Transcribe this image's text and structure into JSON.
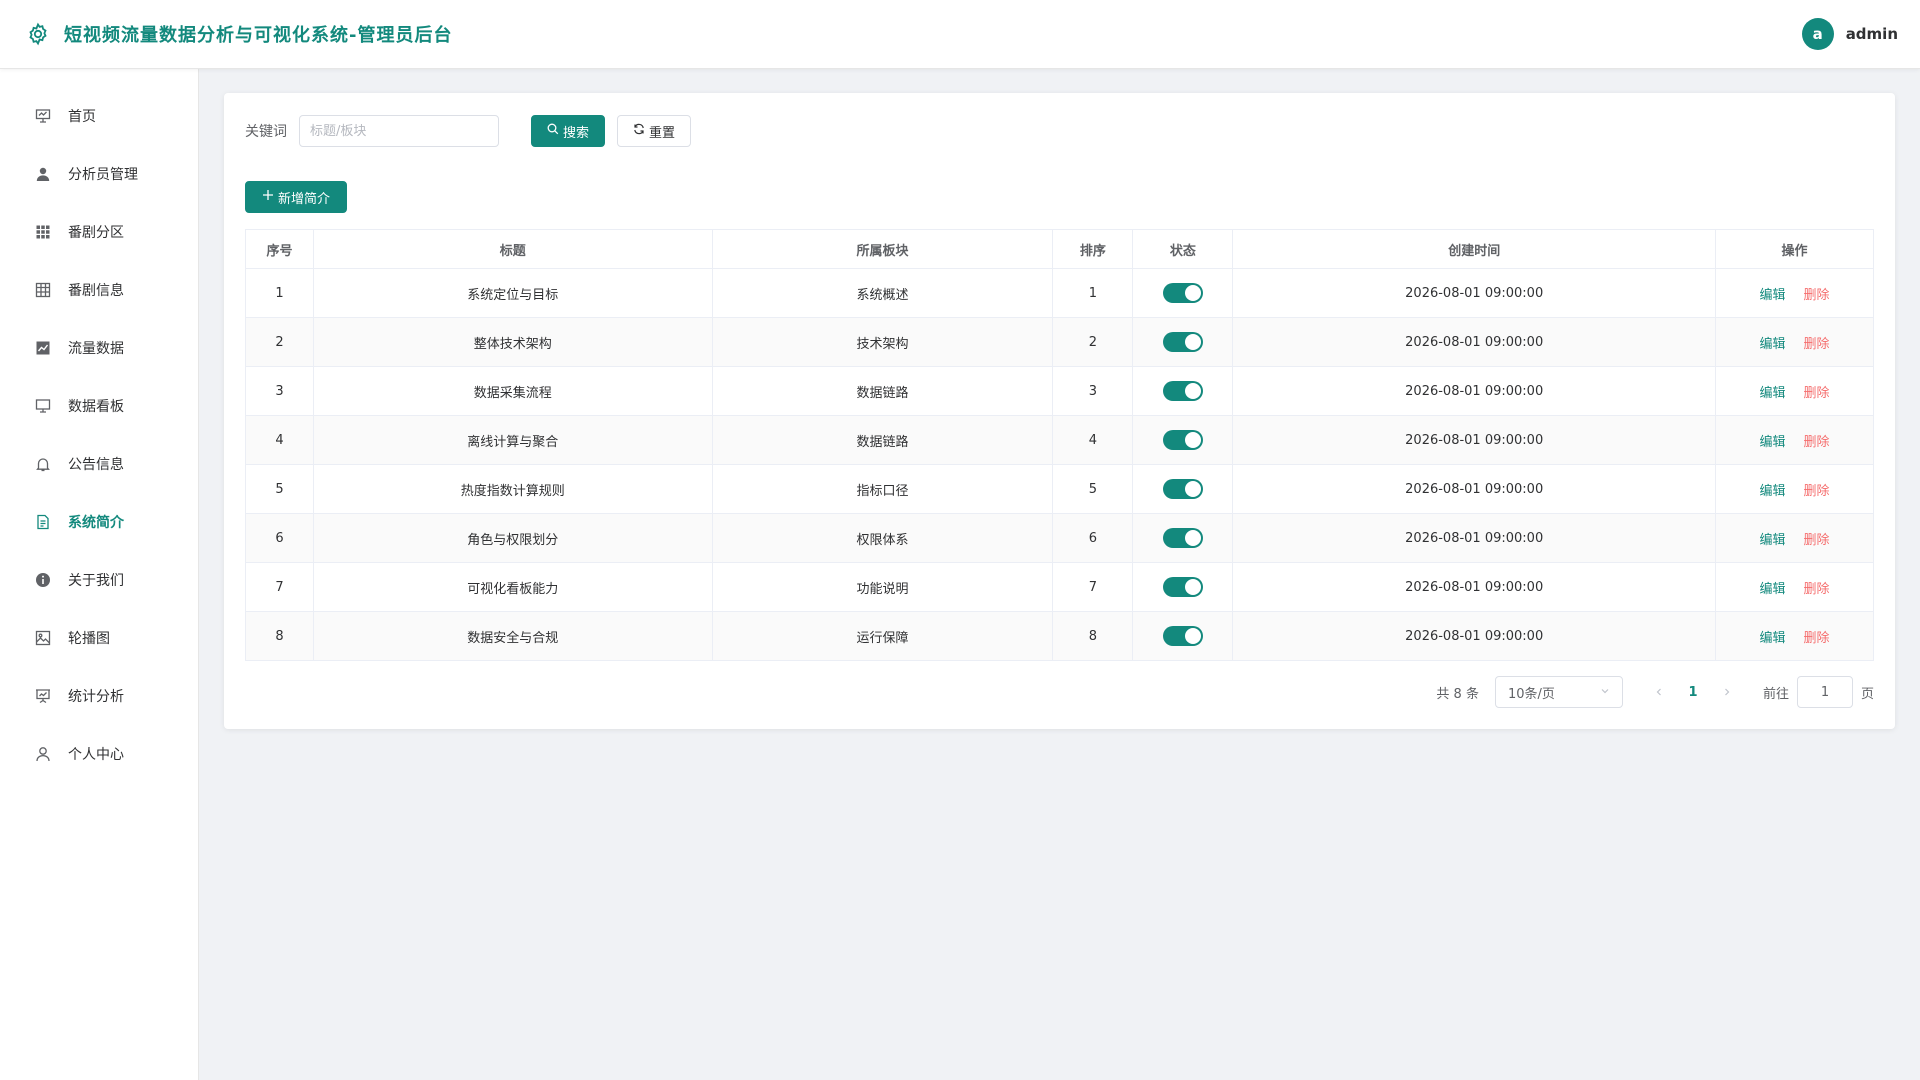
{
  "header": {
    "app_title": "短视频流量数据分析与可视化系统-管理员后台",
    "logo_icon": "gear-icon",
    "avatar_letter": "a",
    "username": "admin"
  },
  "sidebar": {
    "items": [
      {
        "label": "首页",
        "icon": "presentation-icon",
        "active": false
      },
      {
        "label": "分析员管理",
        "icon": "user-icon",
        "active": false
      },
      {
        "label": "番剧分区",
        "icon": "grid-icon",
        "active": false
      },
      {
        "label": "番剧信息",
        "icon": "table-icon",
        "active": false
      },
      {
        "label": "流量数据",
        "icon": "trend-chart-icon",
        "active": false
      },
      {
        "label": "数据看板",
        "icon": "monitor-icon",
        "active": false
      },
      {
        "label": "公告信息",
        "icon": "bell-icon",
        "active": false
      },
      {
        "label": "系统简介",
        "icon": "document-icon",
        "active": true
      },
      {
        "label": "关于我们",
        "icon": "info-icon",
        "active": false
      },
      {
        "label": "轮播图",
        "icon": "picture-icon",
        "active": false
      },
      {
        "label": "统计分析",
        "icon": "data-board-icon",
        "active": false
      },
      {
        "label": "个人中心",
        "icon": "user-outline-icon",
        "active": false
      }
    ]
  },
  "search": {
    "label": "关键词",
    "placeholder": "标题/板块",
    "value": "",
    "search_button": "搜索",
    "reset_button": "重置"
  },
  "actions": {
    "add_button": "新增简介"
  },
  "table": {
    "columns": [
      "序号",
      "标题",
      "所属板块",
      "排序",
      "状态",
      "创建时间",
      "操作"
    ],
    "edit_label": "编辑",
    "delete_label": "删除",
    "rows": [
      {
        "index": "1",
        "title": "系统定位与目标",
        "section": "系统概述",
        "order": "1",
        "enabled": true,
        "created": "2026-08-01 09:00:00"
      },
      {
        "index": "2",
        "title": "整体技术架构",
        "section": "技术架构",
        "order": "2",
        "enabled": true,
        "created": "2026-08-01 09:00:00"
      },
      {
        "index": "3",
        "title": "数据采集流程",
        "section": "数据链路",
        "order": "3",
        "enabled": true,
        "created": "2026-08-01 09:00:00"
      },
      {
        "index": "4",
        "title": "离线计算与聚合",
        "section": "数据链路",
        "order": "4",
        "enabled": true,
        "created": "2026-08-01 09:00:00"
      },
      {
        "index": "5",
        "title": "热度指数计算规则",
        "section": "指标口径",
        "order": "5",
        "enabled": true,
        "created": "2026-08-01 09:00:00"
      },
      {
        "index": "6",
        "title": "角色与权限划分",
        "section": "权限体系",
        "order": "6",
        "enabled": true,
        "created": "2026-08-01 09:00:00"
      },
      {
        "index": "7",
        "title": "可视化看板能力",
        "section": "功能说明",
        "order": "7",
        "enabled": true,
        "created": "2026-08-01 09:00:00"
      },
      {
        "index": "8",
        "title": "数据安全与合规",
        "section": "运行保障",
        "order": "8",
        "enabled": true,
        "created": "2026-08-01 09:00:00"
      }
    ]
  },
  "pagination": {
    "total_text": "共 8 条",
    "page_size": "10条/页",
    "current_page": "1",
    "goto_label": "前往",
    "goto_value": "1",
    "page_suffix": "页"
  },
  "colors": {
    "accent": "#13897d",
    "danger": "#f56c6c",
    "background": "#f0f2f5"
  }
}
